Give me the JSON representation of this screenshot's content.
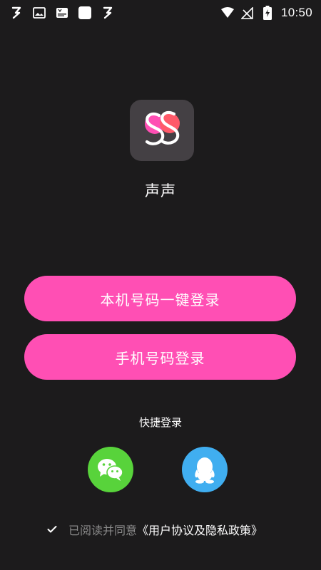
{
  "status_bar": {
    "time": "10:50",
    "left_icons": [
      "app-s-icon",
      "image-icon",
      "news-icon",
      "square-icon",
      "app-s-icon"
    ],
    "right_icons": [
      "wifi-icon",
      "no-signal-icon",
      "battery-charging-icon"
    ]
  },
  "app": {
    "name": "声声",
    "logo_colors": {
      "background": "#444044",
      "pink": "#ff4fb4",
      "coral": "#ff5a6a",
      "outline": "#ffffff"
    }
  },
  "buttons": {
    "one_click_login": "本机号码一键登录",
    "phone_login": "手机号码登录"
  },
  "quick_login": {
    "label": "快捷登录",
    "options": [
      {
        "icon": "wechat-icon",
        "color": "#58d33b"
      },
      {
        "icon": "qq-icon",
        "color": "#40aef0"
      }
    ]
  },
  "agreement": {
    "prefix": "已阅读并同意",
    "link": "《用户协议及隐私政策》",
    "checked": true
  },
  "colors": {
    "background": "#1c1b1c",
    "accent": "#ff4fb4"
  }
}
